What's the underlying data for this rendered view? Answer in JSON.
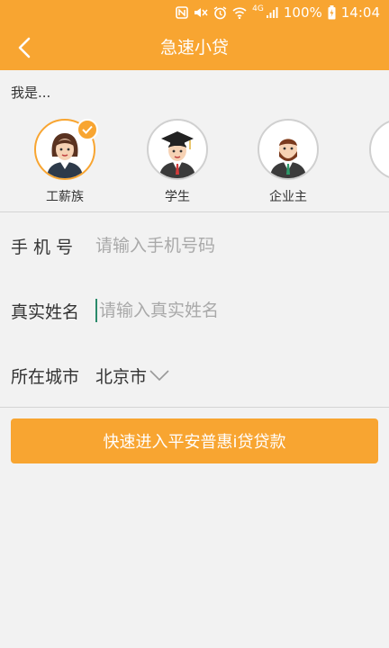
{
  "status_bar": {
    "battery": "100%",
    "time": "14:04",
    "network": "4G"
  },
  "app_bar": {
    "title": "急速小贷"
  },
  "identity": {
    "prompt": "我是...",
    "options": [
      {
        "label": "工薪族",
        "selected": true
      },
      {
        "label": "学生",
        "selected": false
      },
      {
        "label": "企业主",
        "selected": false
      }
    ]
  },
  "form": {
    "phone": {
      "label": "手机号",
      "placeholder": "请输入手机号码",
      "value": ""
    },
    "name": {
      "label": "真实姓名",
      "placeholder": "请输入真实姓名",
      "value": ""
    },
    "city": {
      "label": "所在城市",
      "value": "北京市"
    }
  },
  "submit": {
    "label": "快速进入平安普惠i贷贷款"
  },
  "colors": {
    "accent": "#f8a531",
    "background": "#f2f2f2",
    "text": "#333333",
    "placeholder": "#a9a9a9"
  }
}
